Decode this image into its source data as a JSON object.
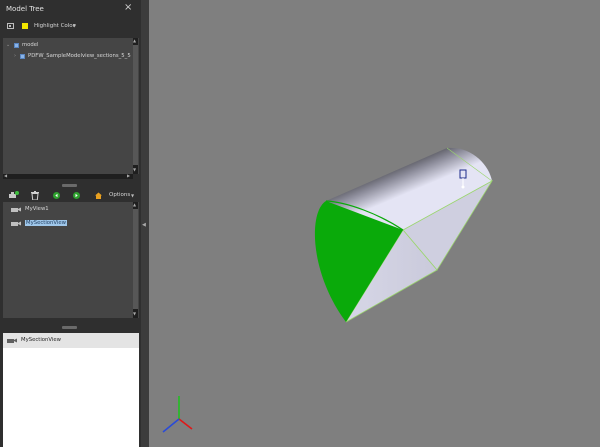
{
  "model_tree": {
    "title": "Model Tree",
    "highlight_color_label": "Highlight Color",
    "highlight_color": "#f2e600",
    "items": [
      {
        "label": "model"
      },
      {
        "label": "PDFW_SampleModelview_sections_5_5"
      }
    ]
  },
  "views": {
    "options_label": "Options",
    "items": [
      {
        "label": "MyView1"
      },
      {
        "label": "MySectionView"
      }
    ]
  },
  "details": {
    "selected_label": "MySectionView"
  },
  "viewport": {
    "background": "#7f7f7f",
    "section_color": "#0aaa0a",
    "axes": {
      "x_color": "#e01818",
      "y_color": "#22c022",
      "z_color": "#2a4bd8"
    }
  },
  "icons": [
    "close-icon",
    "view-mode-icon",
    "color-swatch-icon",
    "dropdown-arrow-icon",
    "tree-check-icon",
    "create-view-icon",
    "delete-icon",
    "previous-view-icon",
    "next-view-icon",
    "home-icon",
    "camera-icon",
    "collapse-panel-icon",
    "triad-icon"
  ]
}
